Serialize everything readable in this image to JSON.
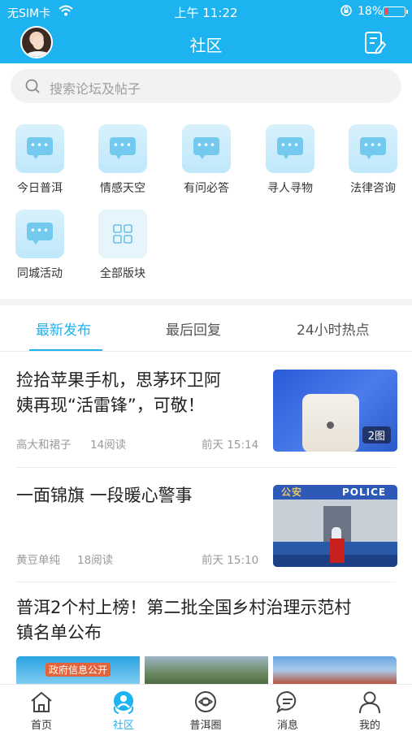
{
  "status_bar": {
    "carrier": "无SIM卡",
    "time": "上午 11:22",
    "battery": "18%"
  },
  "header": {
    "title": "社区"
  },
  "search": {
    "placeholder": "搜索论坛及帖子"
  },
  "categories": [
    {
      "label": "今日普洱",
      "icon": "chat-bubble-icon"
    },
    {
      "label": "情感天空",
      "icon": "chat-bubble-icon"
    },
    {
      "label": "有问必答",
      "icon": "chat-bubble-icon"
    },
    {
      "label": "寻人寻物",
      "icon": "chat-bubble-icon"
    },
    {
      "label": "法律咨询",
      "icon": "chat-bubble-icon"
    },
    {
      "label": "同城活动",
      "icon": "chat-bubble-icon"
    },
    {
      "label": "全部版块",
      "icon": "grid-icon"
    }
  ],
  "tabs": [
    {
      "label": "最新发布",
      "active": true
    },
    {
      "label": "最后回复",
      "active": false
    },
    {
      "label": "24小时热点",
      "active": false
    }
  ],
  "posts": [
    {
      "title_line1": "捡拾苹果手机，思茅环卫阿",
      "title_line2": "姨再现“活雷锋”，可敬！",
      "author": "高大和裙子",
      "reads": "14阅读",
      "time": "前天 15:14",
      "image_badge": "2图"
    },
    {
      "title_line1": "一面锦旗 一段暖心警事",
      "author": "黄豆单纯",
      "reads": "18阅读",
      "time": "前天 15:10",
      "image_sign_left": "公安",
      "image_sign_right": "POLICE"
    },
    {
      "title_line1": "普洱2个村上榜！第二批全国乡村治理示范村",
      "title_line2": "镇名单公布",
      "image_caption": "政府信息公开"
    }
  ],
  "bottom_nav": [
    {
      "label": "首页",
      "icon": "home-icon",
      "active": false
    },
    {
      "label": "社区",
      "icon": "community-icon",
      "active": true
    },
    {
      "label": "普洱圈",
      "icon": "circle-icon",
      "active": false
    },
    {
      "label": "消息",
      "icon": "message-icon",
      "active": false
    },
    {
      "label": "我的",
      "icon": "profile-icon",
      "active": false
    }
  ],
  "colors": {
    "primary": "#1cb3f0",
    "tile": "#bfe8fb",
    "bubble": "#74c9ef"
  }
}
